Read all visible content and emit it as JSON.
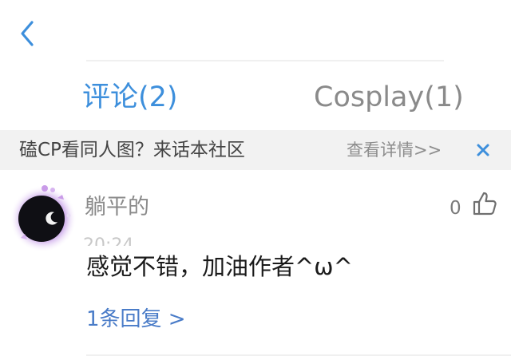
{
  "header": {
    "back_icon": "chevron-left-icon",
    "accent_color": "#3d8fdc"
  },
  "tabs": [
    {
      "label": "评论(2)",
      "active": true
    },
    {
      "label": "Cosplay(1)",
      "active": false
    }
  ],
  "banner": {
    "text": "磕CP看同人图？来话本社区",
    "link_label": "查看详情>>",
    "close_icon": "close-icon"
  },
  "comment": {
    "username": "躺平的",
    "timestamp": "20:24",
    "text": "感觉不错，加油作者^ω^",
    "like_count": "0",
    "like_icon": "thumbs-up-icon",
    "replies_label": "1条回复 >"
  }
}
